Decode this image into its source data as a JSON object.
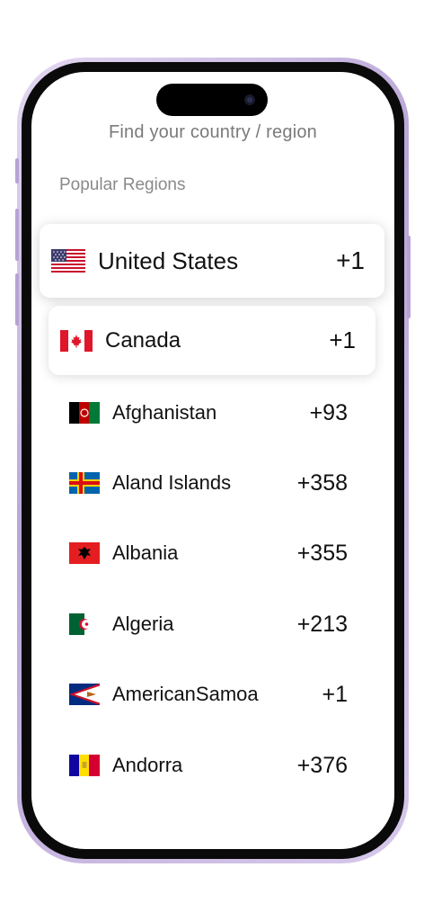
{
  "header": {
    "title": "Find your country / region"
  },
  "popular": {
    "label": "Popular Regions",
    "items": [
      {
        "name": "United States",
        "code": "+1",
        "flag": "us-flag-icon"
      },
      {
        "name": "Canada",
        "code": "+1",
        "flag": "ca-flag-icon"
      }
    ]
  },
  "countries": [
    {
      "name": "Afghanistan",
      "code": "+93",
      "flag": "af-flag-icon"
    },
    {
      "name": "Aland Islands",
      "code": "+358",
      "flag": "ax-flag-icon"
    },
    {
      "name": "Albania",
      "code": "+355",
      "flag": "al-flag-icon"
    },
    {
      "name": "Algeria",
      "code": "+213",
      "flag": "dz-flag-icon"
    },
    {
      "name": "AmericanSamoa",
      "code": "+1",
      "flag": "as-flag-icon"
    },
    {
      "name": "Andorra",
      "code": "+376",
      "flag": "ad-flag-icon"
    }
  ]
}
